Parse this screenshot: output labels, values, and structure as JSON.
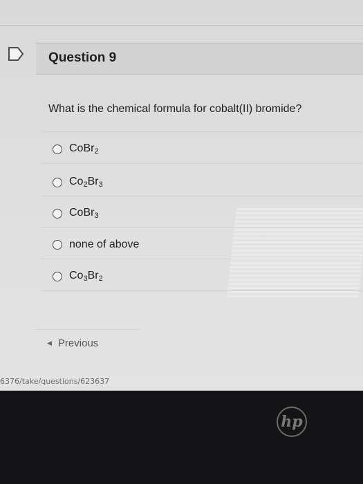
{
  "question": {
    "title": "Question 9",
    "text": "What is the chemical formula for cobalt(II) bromide?"
  },
  "answers": [
    {
      "pre": "CoBr",
      "sub": "2",
      "mid": "",
      "sub2": ""
    },
    {
      "pre": "Co",
      "sub": "2",
      "mid": "Br",
      "sub2": "3"
    },
    {
      "pre": "CoBr",
      "sub": "3",
      "mid": "",
      "sub2": ""
    },
    {
      "pre": "none of above",
      "sub": "",
      "mid": "",
      "sub2": ""
    },
    {
      "pre": "Co",
      "sub": "3",
      "mid": "Br",
      "sub2": "2"
    }
  ],
  "navigation": {
    "previous_label": "Previous"
  },
  "status": {
    "url": "6376/take/questions/623637"
  },
  "bezel": {
    "logo": "hp"
  }
}
